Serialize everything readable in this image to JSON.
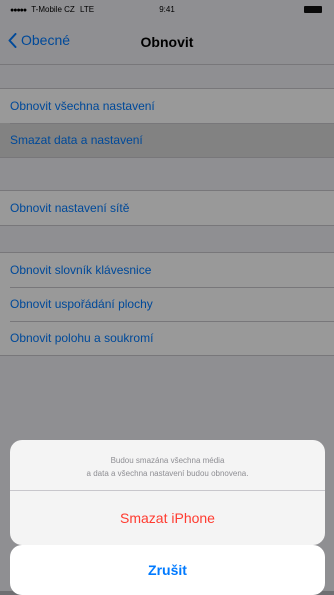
{
  "status_bar": {
    "carrier": "T-Mobile CZ",
    "network": "LTE",
    "time": "9:41",
    "signal_dots": "●●●●●"
  },
  "nav": {
    "back_label": "Obecné",
    "title": "Obnovit"
  },
  "groups": [
    {
      "items": [
        {
          "label": "Obnovit všechna nastavení",
          "selected": false
        },
        {
          "label": "Smazat data a nastavení",
          "selected": true
        }
      ]
    },
    {
      "items": [
        {
          "label": "Obnovit nastavení sítě",
          "selected": false
        }
      ]
    },
    {
      "items": [
        {
          "label": "Obnovit slovník klávesnice",
          "selected": false
        },
        {
          "label": "Obnovit uspořádání plochy",
          "selected": false
        },
        {
          "label": "Obnovit polohu a soukromí",
          "selected": false
        }
      ]
    }
  ],
  "action_sheet": {
    "message_line1": "Budou smazána všechna média",
    "message_line2": "a data a všechna nastavení budou obnovena.",
    "destructive_label": "Smazat iPhone",
    "cancel_label": "Zrušit"
  },
  "colors": {
    "tint": "#007aff",
    "destructive": "#ff3b30",
    "background": "#efeff4"
  }
}
